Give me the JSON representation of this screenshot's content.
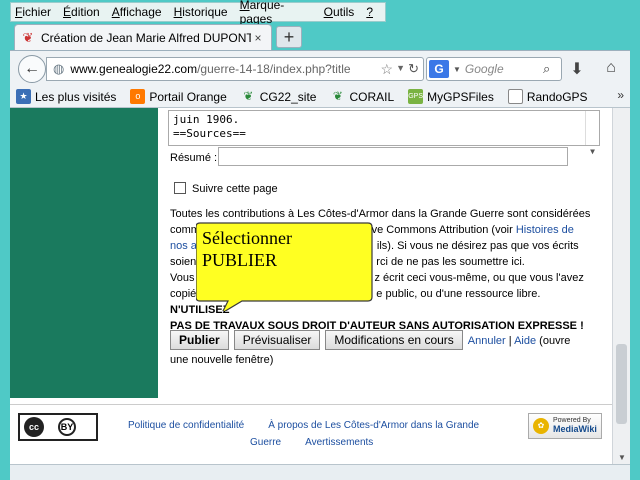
{
  "menubar": {
    "items": [
      {
        "key": "F",
        "rest": "ichier"
      },
      {
        "key": "É",
        "rest": "dition"
      },
      {
        "key": "A",
        "rest": "ffichage"
      },
      {
        "key": "H",
        "rest": "istorique"
      },
      {
        "key": "M",
        "rest": "arque-pages"
      },
      {
        "key": "O",
        "rest": "utils"
      },
      {
        "key": "?",
        "rest": ""
      }
    ]
  },
  "tab": {
    "title": "Création de Jean Marie Alfred DUPONT (...",
    "close": "×",
    "newtab": "+"
  },
  "navbar": {
    "url_domain": "www.genealogie22.com",
    "url_path": "/guerre-14-18/index.php?title",
    "search_engine": "G",
    "search_placeholder": "Google"
  },
  "bookmarks": {
    "items": [
      {
        "label": "Les plus visités",
        "icon": "bookmarks-star-icon"
      },
      {
        "label": "Portail Orange",
        "icon": "orange-icon"
      },
      {
        "label": "CG22_site",
        "icon": "leaf-icon"
      },
      {
        "label": "CORAIL",
        "icon": "leaf-icon"
      },
      {
        "label": "MyGPSFiles",
        "icon": "mygps-icon"
      },
      {
        "label": "RandoGPS",
        "icon": "page-icon"
      }
    ],
    "more": "»"
  },
  "edit": {
    "wikitext": "juin 1906.\n==Sources==",
    "summary_label": "Résumé :",
    "summary_value": "",
    "watch_label": "Suivre cette page",
    "legal_line1": "Toutes les contributions à Les Côtes-d'Armor dans la Grande Guerre sont considérées",
    "legal_line2a": "comm",
    "legal_line2b": "ative Commons Attribution (voir ",
    "legal_line2_link": "Histoires de",
    "legal_line3a": "nos a",
    "legal_line3b": "ils). Si vous ne désirez pas que vos écrits",
    "legal_line4a": "soien",
    "legal_line4b": "rci de ne pas les soumettre ici.",
    "legal_line5a": "Vous",
    "legal_line5b": "z écrit ceci vous-même, ou que vous l'avez",
    "legal_line6a": "copié",
    "legal_line6b": "e public, ou d'une ressource libre. ",
    "legal_line6_bold": "N'UTILISEZ",
    "legal_line7": "PAS DE TRAVAUX SOUS DROIT D'AUTEUR SANS AUTORISATION EXPRESSE !",
    "publish": "Publier",
    "preview": "Prévisualiser",
    "changes": "Modifications en cours",
    "cancel": "Annuler",
    "sep": "|",
    "help": "Aide",
    "tail": "(ouvre",
    "tail2": "une nouvelle fenêtre)"
  },
  "footer": {
    "privacy": "Politique de confidentialité",
    "about": "À propos de Les Côtes-d'Armor dans la Grande",
    "about2": "Guerre",
    "disclaimers": "Avertissements",
    "cc_by": "BY",
    "powered_by": "Powered By",
    "mediawiki": "MediaWiki"
  },
  "callout": {
    "line1": "Sélectionner",
    "line2": "PUBLIER",
    "fill": "#ffff22"
  }
}
